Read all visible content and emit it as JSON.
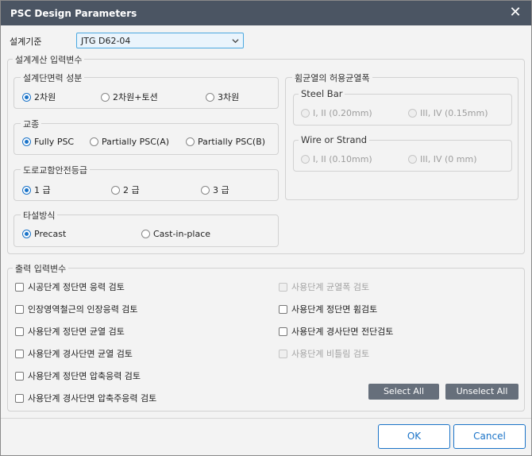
{
  "window": {
    "title": "PSC Design Parameters"
  },
  "design_standard": {
    "label": "설계기준",
    "value": "JTG D62-04"
  },
  "design_input": {
    "legend": "설계계산 입력변수",
    "section_force": {
      "legend": "설계단면력 성분",
      "options": [
        "2차원",
        "2차원+토션",
        "3차원"
      ],
      "selected": 0
    },
    "bridge_type": {
      "legend": "교종",
      "options": [
        "Fully PSC",
        "Partially PSC(A)",
        "Partially PSC(B)"
      ],
      "selected": 0
    },
    "safety_grade": {
      "legend": "도로교함안전등급",
      "options": [
        "1 급",
        "2 급",
        "3 급"
      ],
      "selected": 0
    },
    "casting": {
      "legend": "타설방식",
      "options": [
        "Precast",
        "Cast-in-place"
      ],
      "selected": 0
    }
  },
  "crack_width": {
    "legend": "휨균열의 허용균열폭",
    "steel_bar": {
      "legend": "Steel Bar",
      "options": [
        "I, II (0.20mm)",
        "III, IV (0.15mm)"
      ]
    },
    "wire_strand": {
      "legend": "Wire or Strand",
      "options": [
        "I, II (0.10mm)",
        "III, IV (0 mm)"
      ]
    }
  },
  "output": {
    "legend": "출력 입력변수",
    "left_checks": [
      "시공단계 정단면 응력 검토",
      "인장영역철근의 인장응력 검토",
      "사용단계 정단면 균열 검토",
      "사용단계 경사단면 균열 검토",
      "사용단계 정단면 압축응력 검토",
      "사용단계 경사단면 압축주응력 검토"
    ],
    "right_checks": [
      "사용단계 균열폭 검토",
      "사용단계 정단면 휨검토",
      "사용단계 경사단면 전단검토",
      "사용단계 비틀림 검토"
    ],
    "select_all": "Select All",
    "unselect_all": "Unselect All"
  },
  "buttons": {
    "ok": "OK",
    "cancel": "Cancel"
  }
}
